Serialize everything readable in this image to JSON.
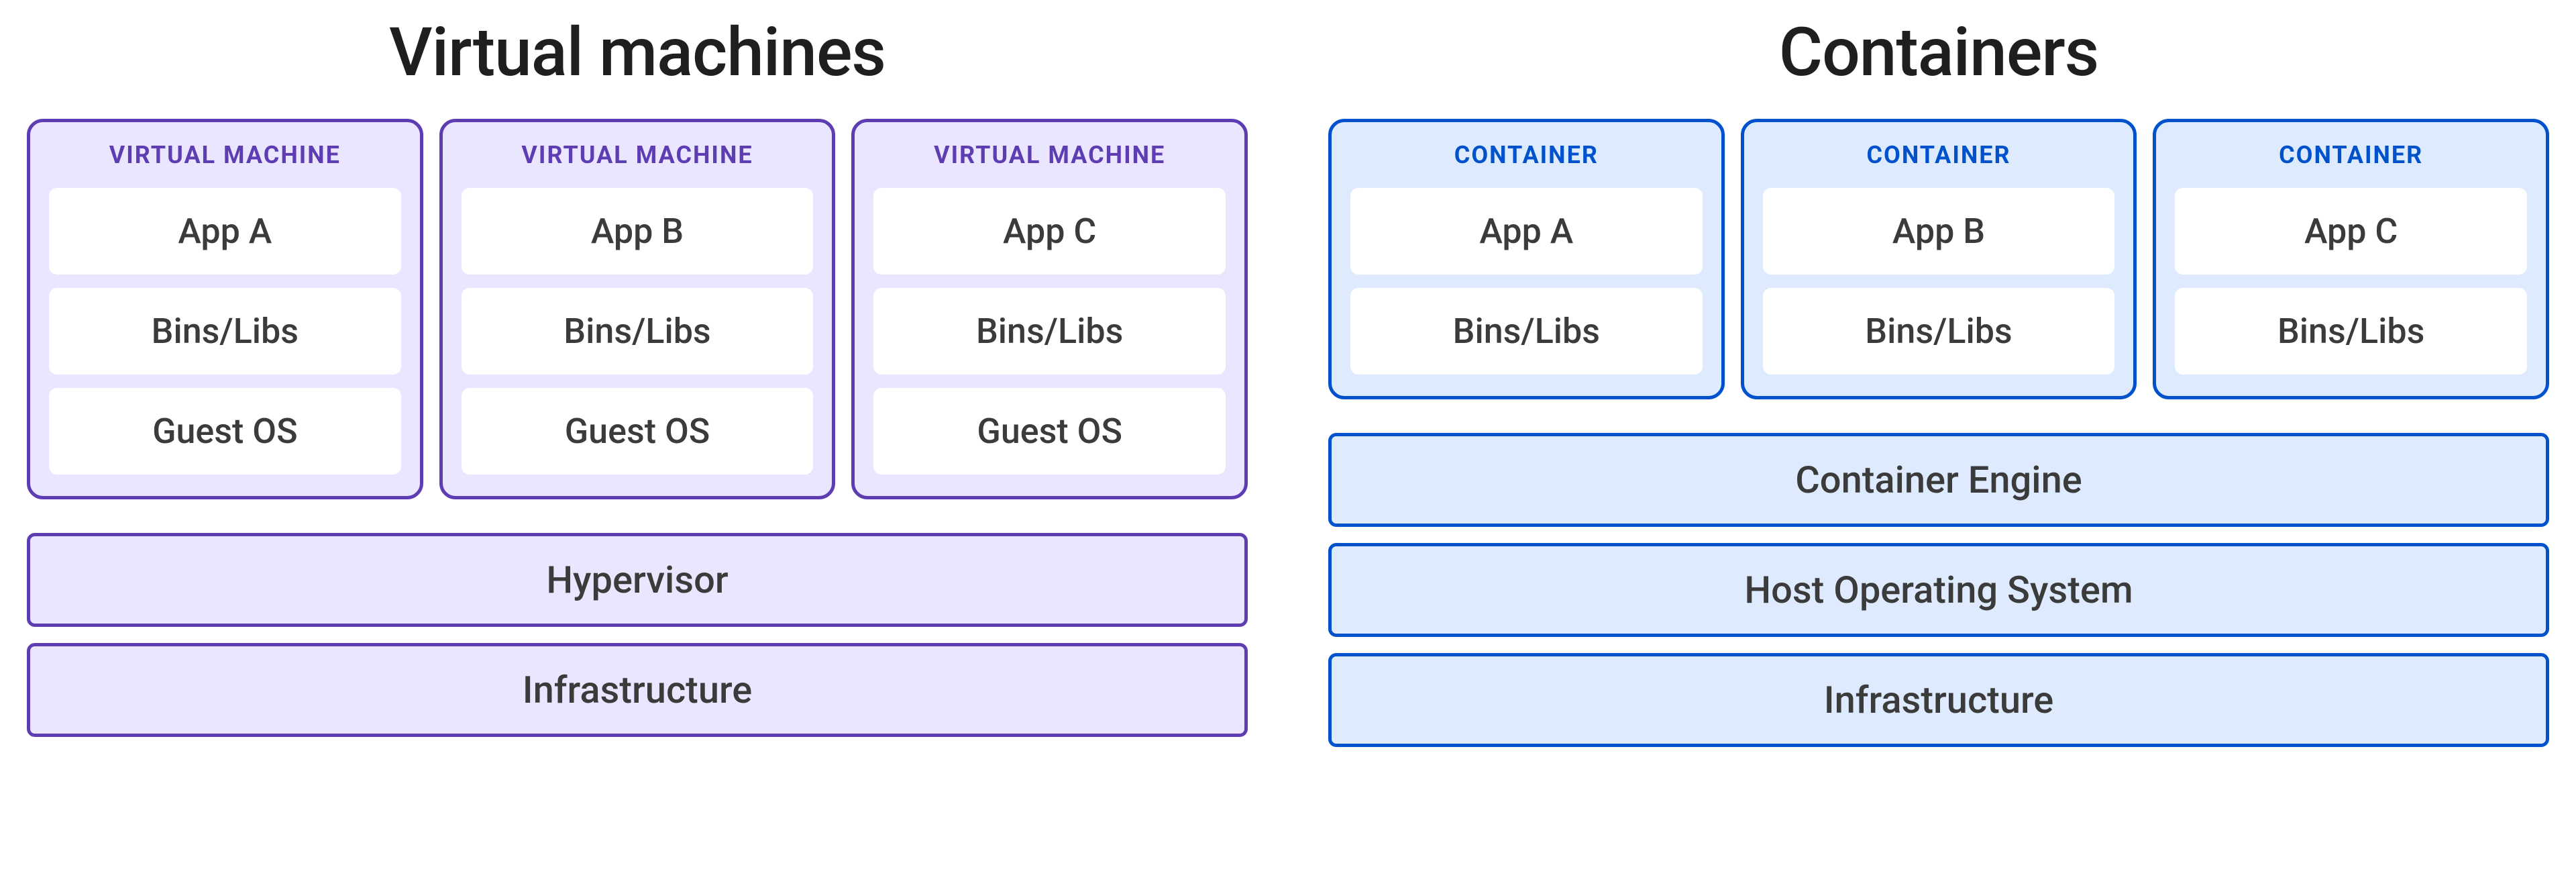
{
  "left": {
    "title": "Virtual machines",
    "units": [
      {
        "header": "VIRTUAL MACHINE",
        "app": "App A",
        "bins": "Bins/Libs",
        "os": "Guest OS"
      },
      {
        "header": "VIRTUAL MACHINE",
        "app": "App B",
        "bins": "Bins/Libs",
        "os": "Guest OS"
      },
      {
        "header": "VIRTUAL MACHINE",
        "app": "App C",
        "bins": "Bins/Libs",
        "os": "Guest OS"
      }
    ],
    "layers": [
      "Hypervisor",
      "Infrastructure"
    ]
  },
  "right": {
    "title": "Containers",
    "units": [
      {
        "header": "CONTAINER",
        "app": "App A",
        "bins": "Bins/Libs"
      },
      {
        "header": "CONTAINER",
        "app": "App B",
        "bins": "Bins/Libs"
      },
      {
        "header": "CONTAINER",
        "app": "App C",
        "bins": "Bins/Libs"
      }
    ],
    "layers": [
      "Container Engine",
      "Host Operating System",
      "Infrastructure"
    ]
  },
  "colors": {
    "purple_fill": "#EAE6FF",
    "purple_border": "#5E3DB3",
    "blue_fill": "#DEEBFF",
    "blue_border": "#0052CC"
  }
}
